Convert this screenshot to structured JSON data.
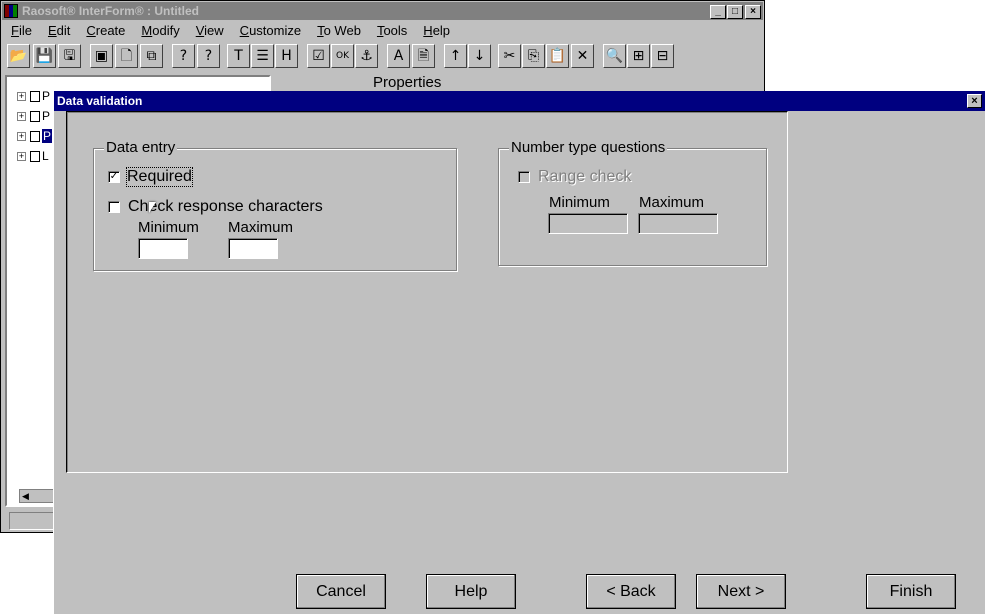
{
  "app": {
    "title": "Raosoft® InterForm® : Untitled",
    "window_buttons": [
      "_",
      "□",
      "×"
    ],
    "menu": [
      "File",
      "Edit",
      "Create",
      "Modify",
      "View",
      "Customize",
      "To Web",
      "Tools",
      "Help"
    ],
    "properties_title": "Properties",
    "tree_items": [
      {
        "label": "P",
        "selected": false
      },
      {
        "label": "P",
        "selected": false
      },
      {
        "label": "P",
        "selected": true
      },
      {
        "label": "L",
        "selected": false
      }
    ],
    "toolbar": [
      {
        "name": "open-icon",
        "glyph": "📂"
      },
      {
        "name": "save-icon",
        "glyph": "💾"
      },
      {
        "name": "save-as-icon",
        "glyph": "🖫"
      },
      {
        "name": "form-icon",
        "glyph": "▣"
      },
      {
        "name": "new-page-icon",
        "glyph": "🗋"
      },
      {
        "name": "copy-page-icon",
        "glyph": "⧉"
      },
      {
        "name": "question-icon",
        "glyph": "?"
      },
      {
        "name": "question-multi-icon",
        "glyph": "?"
      },
      {
        "name": "text-icon",
        "glyph": "T"
      },
      {
        "name": "list-icon",
        "glyph": "☰"
      },
      {
        "name": "heading-icon",
        "glyph": "H"
      },
      {
        "name": "checkbox-control-icon",
        "glyph": "☑"
      },
      {
        "name": "ok-button-icon",
        "glyph": "OK"
      },
      {
        "name": "anchor-icon",
        "glyph": "⚓"
      },
      {
        "name": "font-color-icon",
        "glyph": "A"
      },
      {
        "name": "properties-icon",
        "glyph": "🗎"
      },
      {
        "name": "move-up-icon",
        "glyph": "↑"
      },
      {
        "name": "move-down-icon",
        "glyph": "↓"
      },
      {
        "name": "cut-icon",
        "glyph": "✂"
      },
      {
        "name": "copy-icon",
        "glyph": "⎘"
      },
      {
        "name": "paste-icon",
        "glyph": "📋"
      },
      {
        "name": "delete-icon",
        "glyph": "✕"
      },
      {
        "name": "zoom-icon",
        "glyph": "🔍"
      },
      {
        "name": "expand-icon",
        "glyph": "⊞"
      },
      {
        "name": "collapse-icon",
        "glyph": "⊟"
      }
    ]
  },
  "dialog": {
    "title": "Data validation",
    "close": "×",
    "data_entry": {
      "legend": "Data entry",
      "required_label": "Required",
      "required_checked": true,
      "check_chars_label": "Check response characters",
      "check_chars_checked": false,
      "min_label": "Minimum",
      "max_label": "Maximum",
      "min_value": "",
      "max_value": ""
    },
    "number_type": {
      "legend": "Number type questions",
      "range_label": "Range check",
      "range_checked": false,
      "min_label": "Minimum",
      "max_label": "Maximum",
      "min_value": "",
      "max_value": ""
    },
    "buttons": {
      "cancel": "Cancel",
      "help": "Help",
      "back": "< Back",
      "next": "Next >",
      "finish": "Finish"
    },
    "check_glyph": "✓"
  }
}
